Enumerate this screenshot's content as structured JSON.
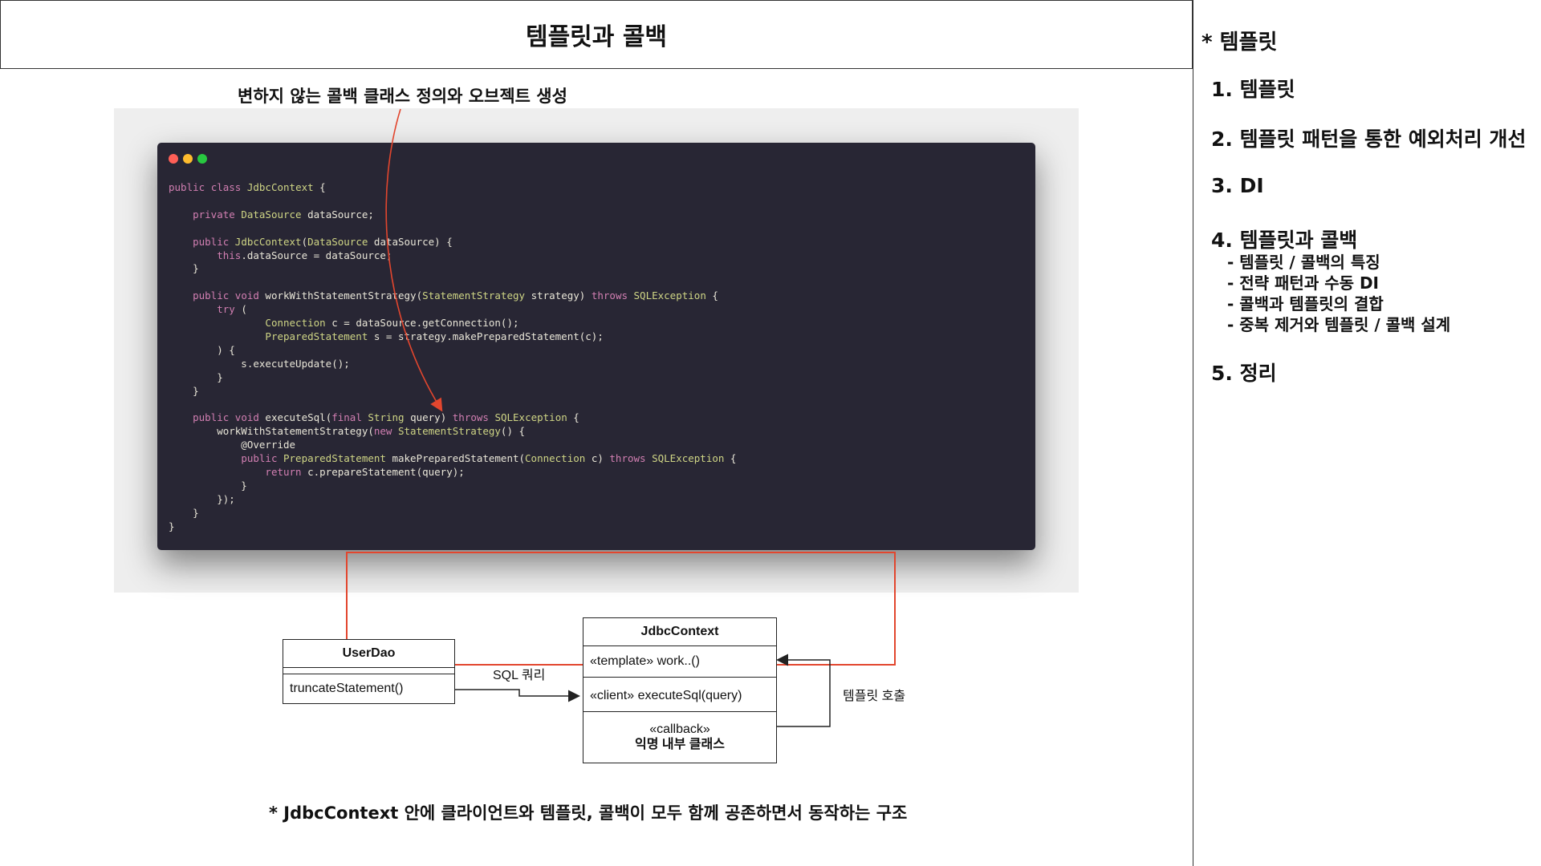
{
  "slide": {
    "title": "템플릿과 콜백",
    "annotation": "변하지 않는 콜백 클래스 정의와 오브젝트 생성",
    "footer_note": "* JdbcContext 안에 클라이언트와 템플릿, 콜백이 모두 함께 공존하면서 동작하는 구조"
  },
  "code": {
    "lines": [
      "public class JdbcContext {",
      "",
      "    private DataSource dataSource;",
      "",
      "    public JdbcContext(DataSource dataSource) {",
      "        this.dataSource = dataSource;",
      "    }",
      "",
      "    public void workWithStatementStrategy(StatementStrategy strategy) throws SQLException {",
      "        try (",
      "                Connection c = dataSource.getConnection();",
      "                PreparedStatement s = strategy.makePreparedStatement(c);",
      "        ) {",
      "            s.executeUpdate();",
      "        }",
      "    }",
      "",
      "    public void executeSql(final String query) throws SQLException {",
      "        workWithStatementStrategy(new StatementStrategy() {",
      "            @Override",
      "            public PreparedStatement makePreparedStatement(Connection c) throws SQLException {",
      "                return c.prepareStatement(query);",
      "            }",
      "        });",
      "    }",
      "}"
    ]
  },
  "diagram": {
    "userdao": {
      "name": "UserDao",
      "method": "truncateStatement()"
    },
    "jdbccontext": {
      "name": "JdbcContext",
      "template_row": "«template» work..()",
      "client_row": "«client» executeSql(query)",
      "callback_stereotype": "«callback»",
      "callback_name": "익명 내부 클래스"
    },
    "sql_label": "SQL 쿼리",
    "template_call_label": "템플릿 호출"
  },
  "sidebar": {
    "title": "* 템플릿",
    "items": [
      {
        "label": "1.  템플릿"
      },
      {
        "label": "2. 템플릿 패턴을 통한 예외처리 개선"
      },
      {
        "label": "3. DI"
      },
      {
        "label": "4. 템플릿과 콜백"
      },
      {
        "label": "5. 정리"
      }
    ],
    "subitems": [
      {
        "label": "- 템플릿 / 콜백의 특징"
      },
      {
        "label": "- 전략 패턴과 수동 DI"
      },
      {
        "label": "- 콜백과 템플릿의 결합"
      },
      {
        "label": "- 중복 제거와 템플릿 / 콜백 설계"
      }
    ]
  },
  "colors": {
    "code_background": "#282634",
    "keyword": "#d27fb2",
    "type": "#cfd585",
    "highlight": "#e2462e"
  }
}
